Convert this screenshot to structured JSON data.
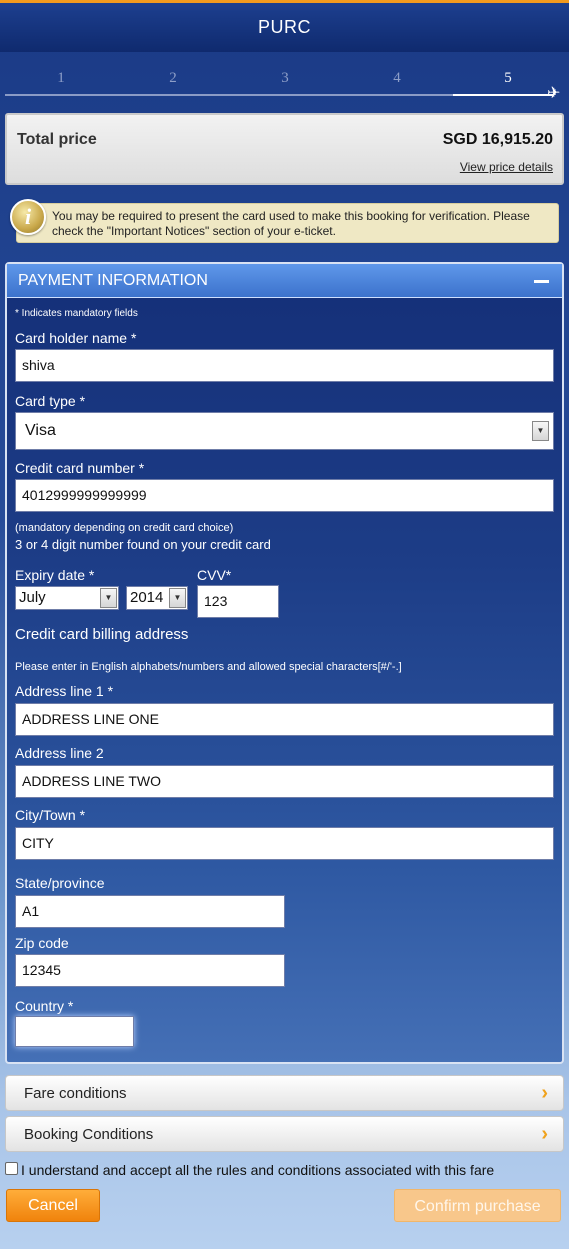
{
  "header": {
    "title": "PURC"
  },
  "progress": {
    "steps": [
      "1",
      "2",
      "3",
      "4",
      "5"
    ],
    "current_step": 5
  },
  "total": {
    "label": "Total price",
    "value": "SGD 16,915.20",
    "details_link": "View price details"
  },
  "notice": {
    "icon": "info-icon",
    "text": "You may be required to present the card used to make this booking for verification. Please check the \"Important Notices\" section of your e-ticket."
  },
  "payment": {
    "title": "PAYMENT INFORMATION",
    "mandatory_note": "* Indicates mandatory fields",
    "card_holder": {
      "label": "Card holder name *",
      "value": "shiva"
    },
    "card_type": {
      "label": "Card type *",
      "value": "Visa"
    },
    "card_number": {
      "label": "Credit card number *",
      "value": "4012999999999999"
    },
    "cvv_hint_small": "(mandatory depending on credit card choice)",
    "cvv_hint": "3 or 4 digit number found on your credit card",
    "expiry": {
      "label": "Expiry date *",
      "month": "July",
      "year": "2014"
    },
    "cvv": {
      "label": "CVV*",
      "value": "123"
    },
    "billing_title": "Credit card billing address",
    "billing_note": "Please enter in English alphabets/numbers and allowed special characters[#/'-.]",
    "address1": {
      "label": "Address line 1 *",
      "value": "ADDRESS LINE ONE"
    },
    "address2": {
      "label": "Address line 2",
      "value": "ADDRESS LINE TWO"
    },
    "city": {
      "label": "City/Town *",
      "value": "CITY"
    },
    "state": {
      "label": "State/province",
      "value": "A1"
    },
    "zip": {
      "label": "Zip code",
      "value": "12345"
    },
    "country": {
      "label": "Country *",
      "value": ""
    }
  },
  "accordions": {
    "fare": "Fare conditions",
    "booking": "Booking Conditions"
  },
  "accept_text": "I understand and accept all the rules and conditions associated with this fare",
  "buttons": {
    "cancel": "Cancel",
    "confirm": "Confirm purchase"
  },
  "colors": {
    "accent": "#f39a1e",
    "header": "#1d3f8f",
    "panel_header": "#4a82dc"
  }
}
